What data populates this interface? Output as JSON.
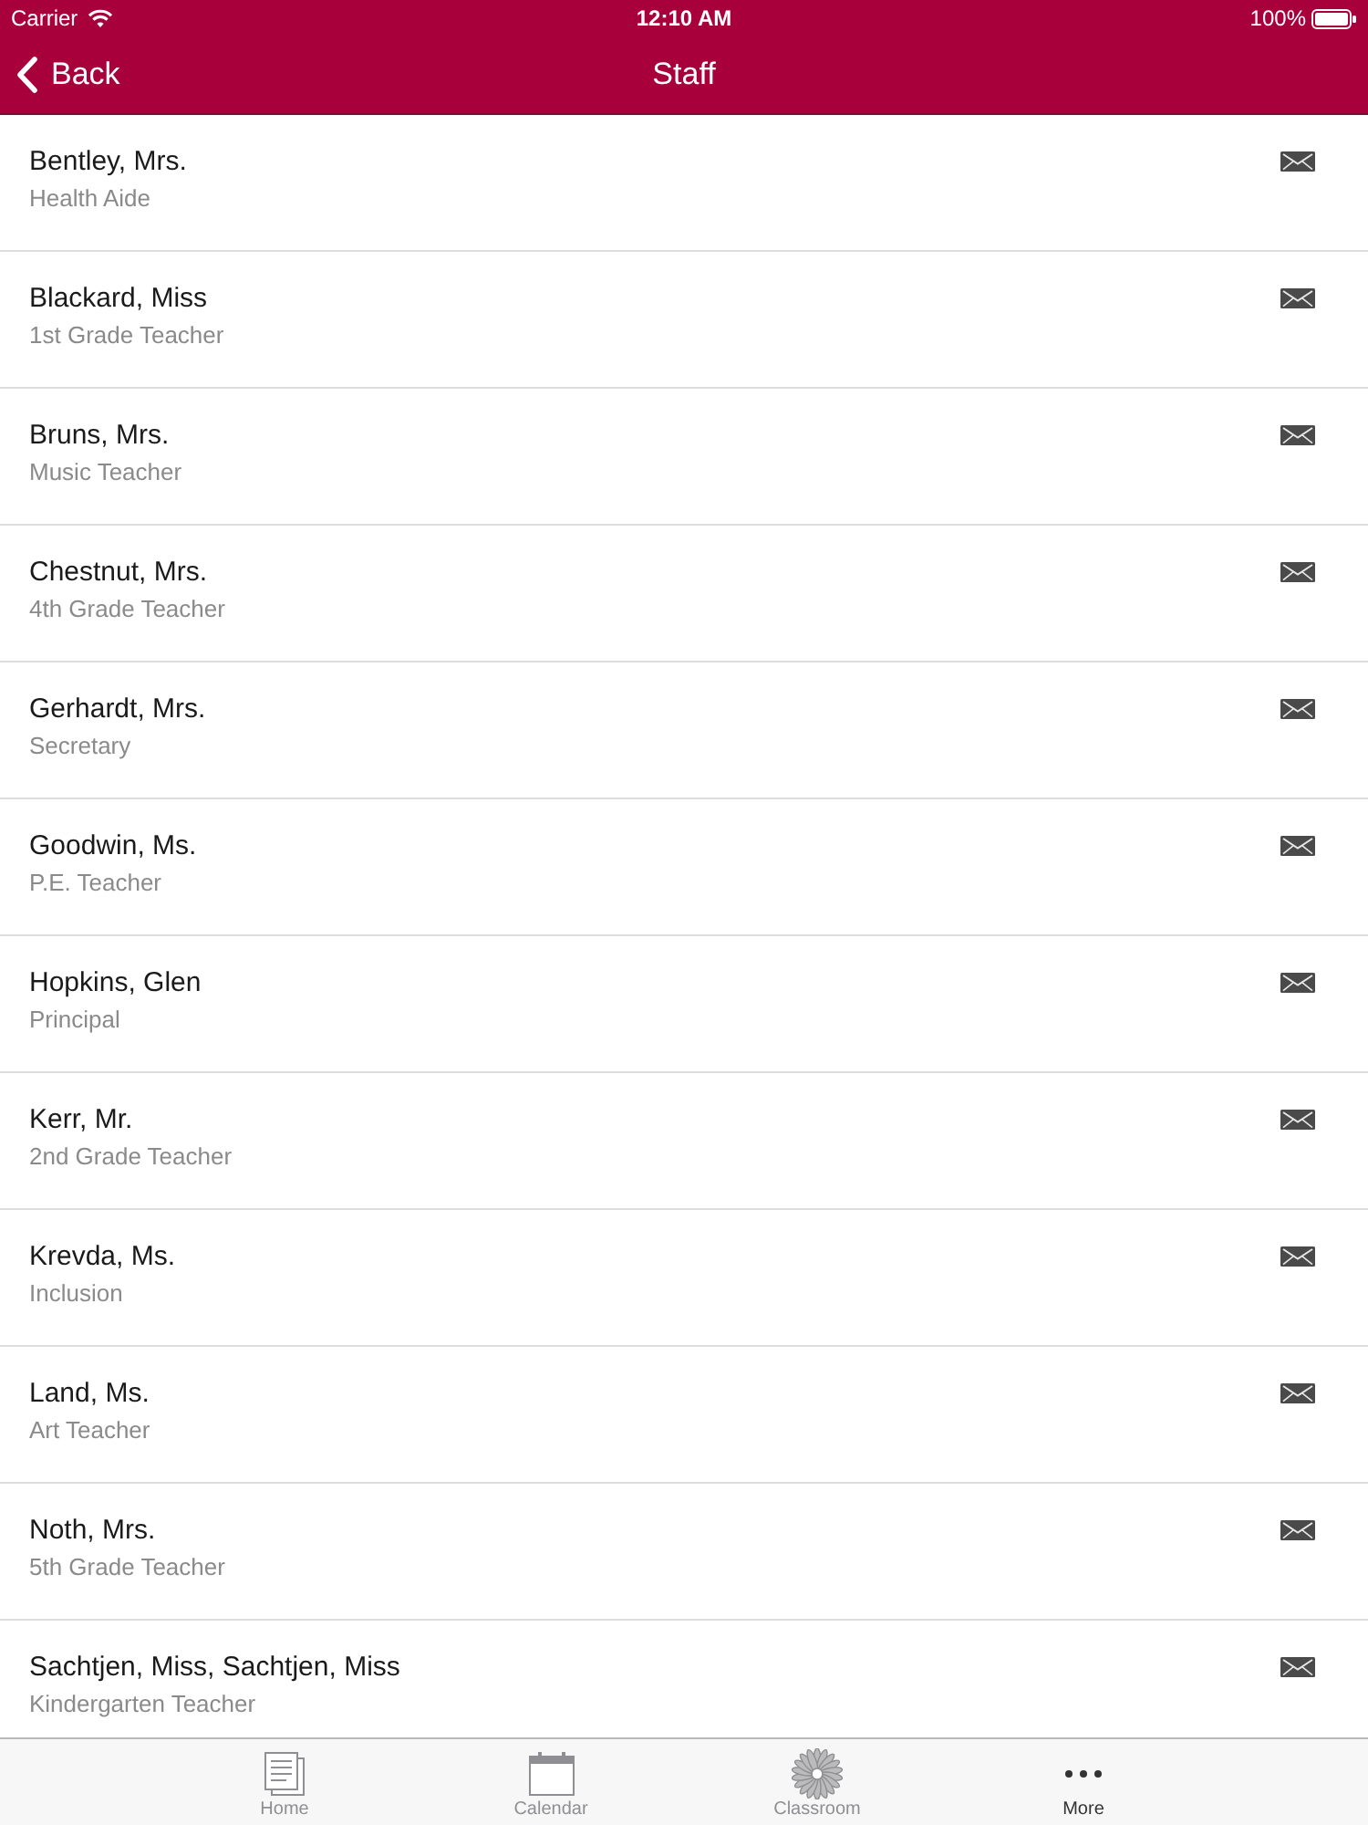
{
  "status_bar": {
    "carrier": "Carrier",
    "time": "12:10 AM",
    "battery": "100%"
  },
  "nav_bar": {
    "back": "Back",
    "title": "Staff"
  },
  "staff": [
    {
      "name": "Bentley, Mrs.",
      "role": "Health Aide"
    },
    {
      "name": "Blackard, Miss",
      "role": "1st Grade Teacher"
    },
    {
      "name": "Bruns, Mrs.",
      "role": "Music Teacher"
    },
    {
      "name": "Chestnut, Mrs.",
      "role": "4th Grade Teacher"
    },
    {
      "name": "Gerhardt, Mrs.",
      "role": "Secretary"
    },
    {
      "name": "Goodwin, Ms.",
      "role": "P.E. Teacher"
    },
    {
      "name": "Hopkins, Glen",
      "role": "Principal"
    },
    {
      "name": "Kerr, Mr.",
      "role": "2nd Grade Teacher"
    },
    {
      "name": "Krevda, Ms.",
      "role": "Inclusion"
    },
    {
      "name": "Land, Ms.",
      "role": "Art Teacher"
    },
    {
      "name": "Noth, Mrs.",
      "role": "5th Grade Teacher"
    },
    {
      "name": "Sachtjen, Miss, Sachtjen, Miss",
      "role": "Kindergarten Teacher"
    }
  ],
  "tab_bar": [
    {
      "kind": "home",
      "label": "Home",
      "selected": false
    },
    {
      "kind": "calendar",
      "label": "Calendar",
      "selected": false
    },
    {
      "kind": "classroom",
      "label": "Classroom",
      "selected": false
    },
    {
      "kind": "more",
      "label": "More",
      "selected": true
    }
  ]
}
